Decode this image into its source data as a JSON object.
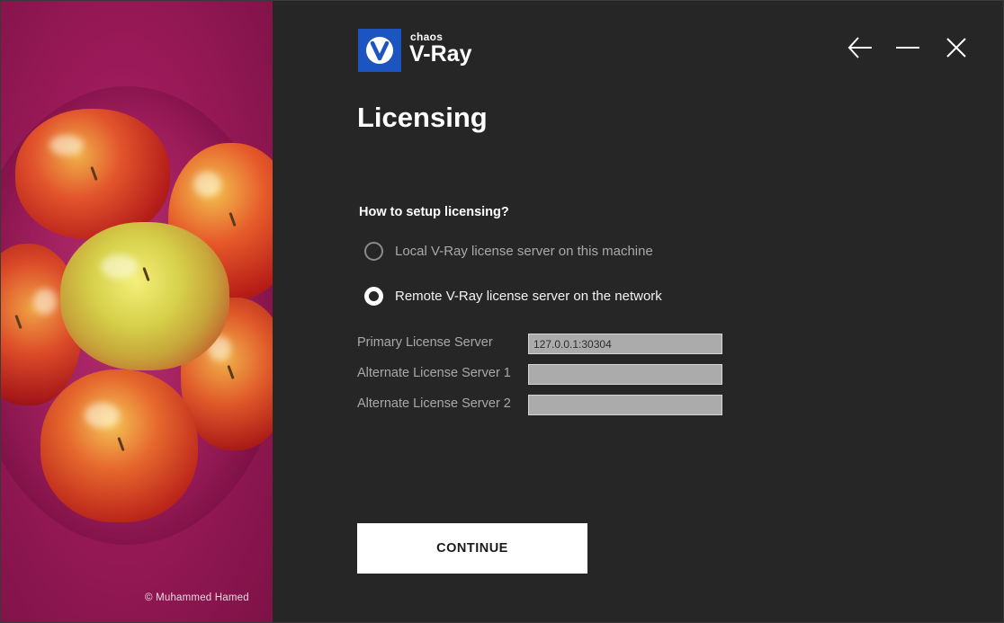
{
  "brand": {
    "company": "chaos",
    "product": "V-Ray",
    "logo_icon": "vray-v-icon",
    "accent_color": "#1d55c0"
  },
  "art": {
    "credit": "© Muhammed Hamed",
    "background_color": "#9a1a58"
  },
  "window_controls": {
    "back_icon": "arrow-left-icon",
    "minimize_icon": "minimize-icon",
    "close_icon": "close-icon"
  },
  "page": {
    "title": "Licensing",
    "question": "How to setup licensing?"
  },
  "options": [
    {
      "label": "Local V-Ray license server on this machine",
      "selected": false
    },
    {
      "label": "Remote V-Ray license server on the network",
      "selected": true
    }
  ],
  "fields": [
    {
      "label": "Primary License Server",
      "value": "127.0.0.1:30304"
    },
    {
      "label": "Alternate License Server 1",
      "value": ""
    },
    {
      "label": "Alternate License Server 2",
      "value": ""
    }
  ],
  "actions": {
    "continue_label": "CONTINUE"
  }
}
